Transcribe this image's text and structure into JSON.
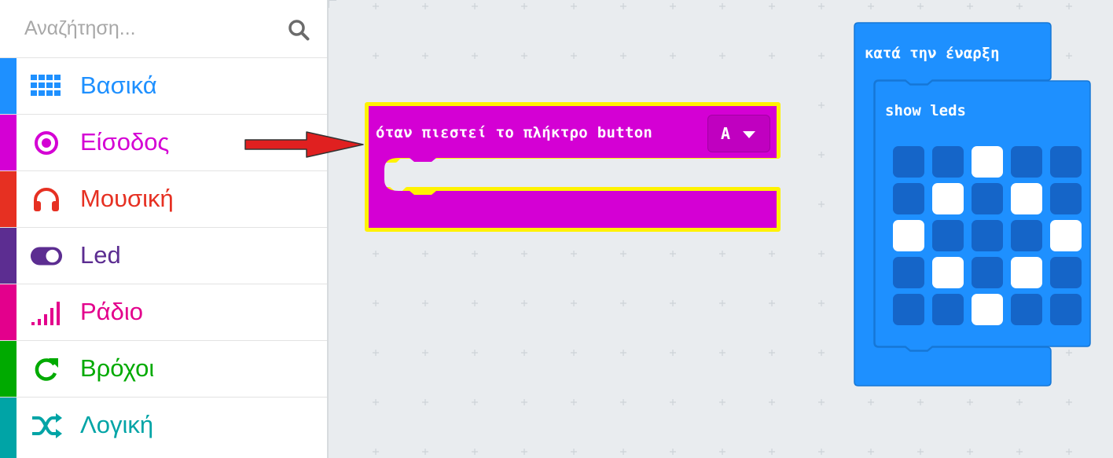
{
  "search": {
    "placeholder": "Αναζήτηση...",
    "icon": "search-icon"
  },
  "categories": [
    {
      "label": "Βασικά",
      "color": "#1e90ff",
      "icon": "grid-icon"
    },
    {
      "label": "Είσοδος",
      "color": "#d400d4",
      "icon": "target-icon"
    },
    {
      "label": "Μουσική",
      "color": "#e63022",
      "icon": "headphones-icon"
    },
    {
      "label": "Led",
      "color": "#5c2d91",
      "icon": "toggle-icon"
    },
    {
      "label": "Ράδιο",
      "color": "#e3008c",
      "icon": "signal-bars-icon"
    },
    {
      "label": "Βρόχοι",
      "color": "#00aa00",
      "icon": "loop-icon"
    },
    {
      "label": "Λογική",
      "color": "#00a4a6",
      "icon": "shuffle-icon"
    }
  ],
  "event_block": {
    "title": "όταν πιεστεί το πλήκτρο button",
    "dropdown_value": "A",
    "color": "#d400d4",
    "highlight": "#fff200"
  },
  "start_block": {
    "title": "κατά την έναρξη",
    "inner_title": "show leds",
    "color": "#1e90ff",
    "led_on": "#ffffff",
    "led_off": "#1565c8",
    "leds": [
      [
        0,
        0,
        1,
        0,
        0
      ],
      [
        0,
        1,
        0,
        1,
        0
      ],
      [
        1,
        0,
        0,
        0,
        1
      ],
      [
        0,
        1,
        0,
        1,
        0
      ],
      [
        0,
        0,
        1,
        0,
        0
      ]
    ]
  },
  "annotation_arrow_color": "#e02020"
}
